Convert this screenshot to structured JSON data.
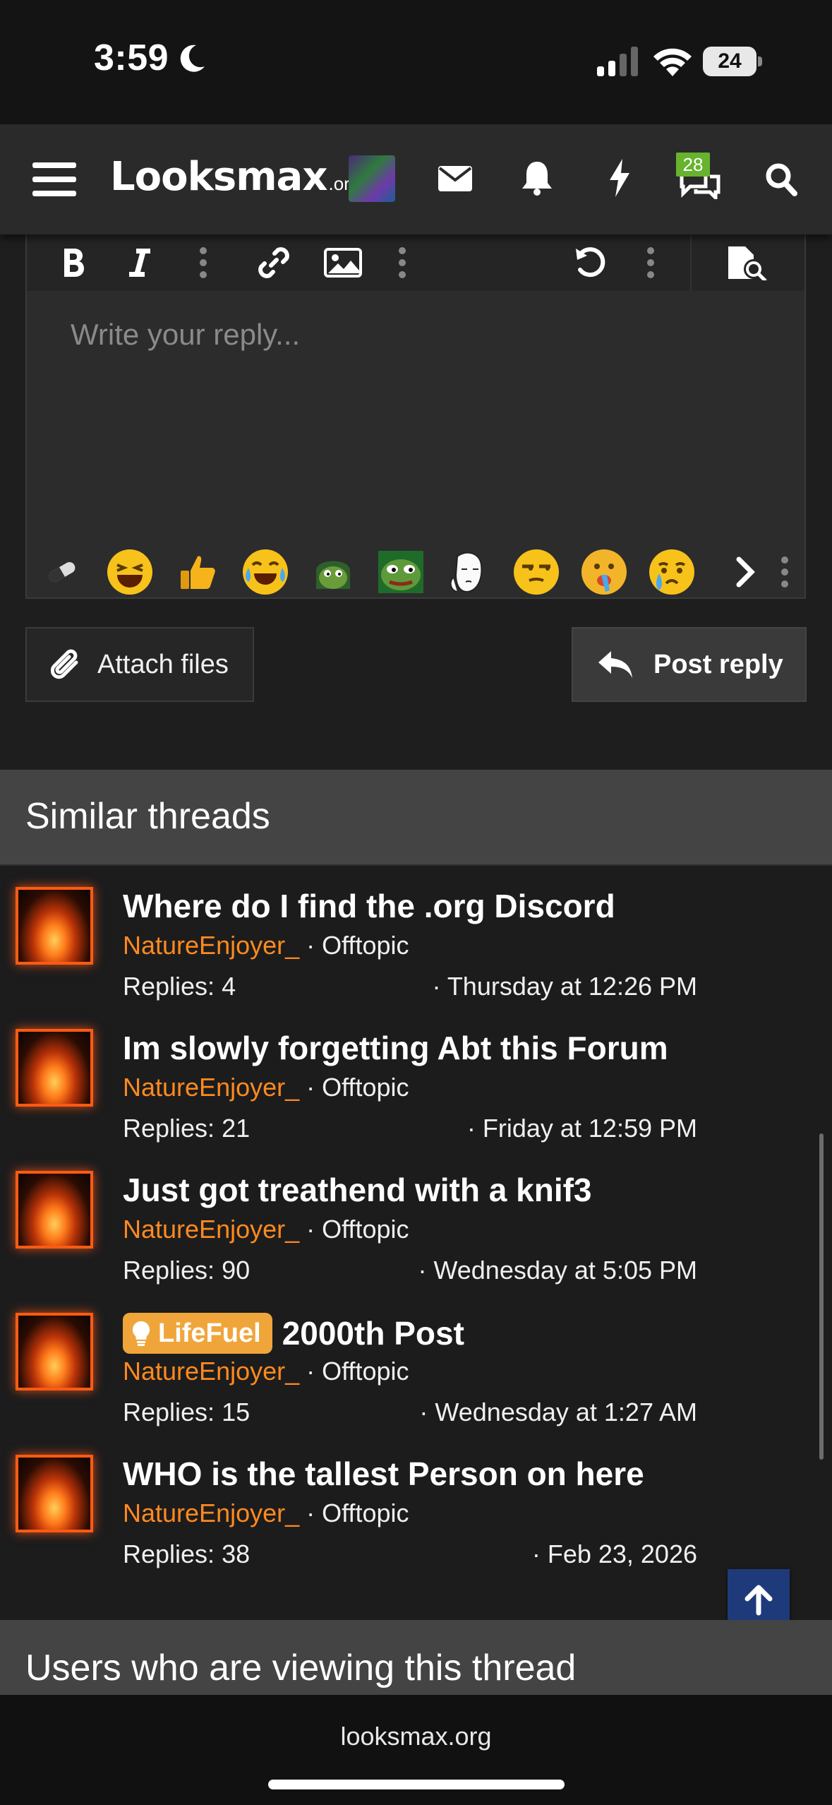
{
  "status_bar": {
    "time": "3:59",
    "battery": "24"
  },
  "nav": {
    "logo_main": "Looksmax",
    "logo_org": ".org",
    "badge_count": "28",
    "icons": [
      "menu-icon",
      "mail-icon",
      "bell-icon",
      "bolt-icon",
      "chat-icon",
      "search-icon"
    ]
  },
  "editor": {
    "placeholder": "Write your reply...",
    "toolbar": [
      "bold-icon",
      "italic-icon",
      "more-icon",
      "link-icon",
      "image-icon",
      "more-icon",
      "undo-icon",
      "more-icon",
      "preview-icon"
    ],
    "emojis": [
      "pill",
      "laughing",
      "thumbs-up",
      "crying-laughing",
      "pepe-hood",
      "pepe",
      "wojak",
      "unamused",
      "sick",
      "crying"
    ]
  },
  "buttons": {
    "attach": "Attach files",
    "post": "Post reply"
  },
  "similar": {
    "header": "Similar threads",
    "threads": [
      {
        "title": "Where do I find the .org Discord",
        "prefix": "",
        "user": "NatureEnjoyer_",
        "forum": "Offtopic",
        "replies": "Replies: 4",
        "date": "Thursday at 12:26 PM"
      },
      {
        "title": "Im slowly forgetting Abt this Forum",
        "prefix": "",
        "user": "NatureEnjoyer_",
        "forum": "Offtopic",
        "replies": "Replies: 21",
        "date": "Friday at 12:59 PM"
      },
      {
        "title": "Just got treathend with a knif3",
        "prefix": "",
        "user": "NatureEnjoyer_",
        "forum": "Offtopic",
        "replies": "Replies: 90",
        "date": "Wednesday at 5:05 PM"
      },
      {
        "title": "2000th Post",
        "prefix": "LifeFuel",
        "user": "NatureEnjoyer_",
        "forum": "Offtopic",
        "replies": "Replies: 15",
        "date": "Wednesday at 1:27 AM"
      },
      {
        "title": "WHO is the tallest Person on here",
        "prefix": "",
        "user": "NatureEnjoyer_",
        "forum": "Offtopic",
        "replies": "Replies: 38",
        "date": "Feb 23, 2026"
      }
    ]
  },
  "users_header": "Users who are viewing this thread",
  "bottom_url": "looksmax.org",
  "colors": {
    "accent_orange": "#ff8a1f",
    "prefix_bg": "#f0a53b",
    "badge_green": "#67b32e",
    "scroll_top_bg": "#1e3a7a"
  }
}
